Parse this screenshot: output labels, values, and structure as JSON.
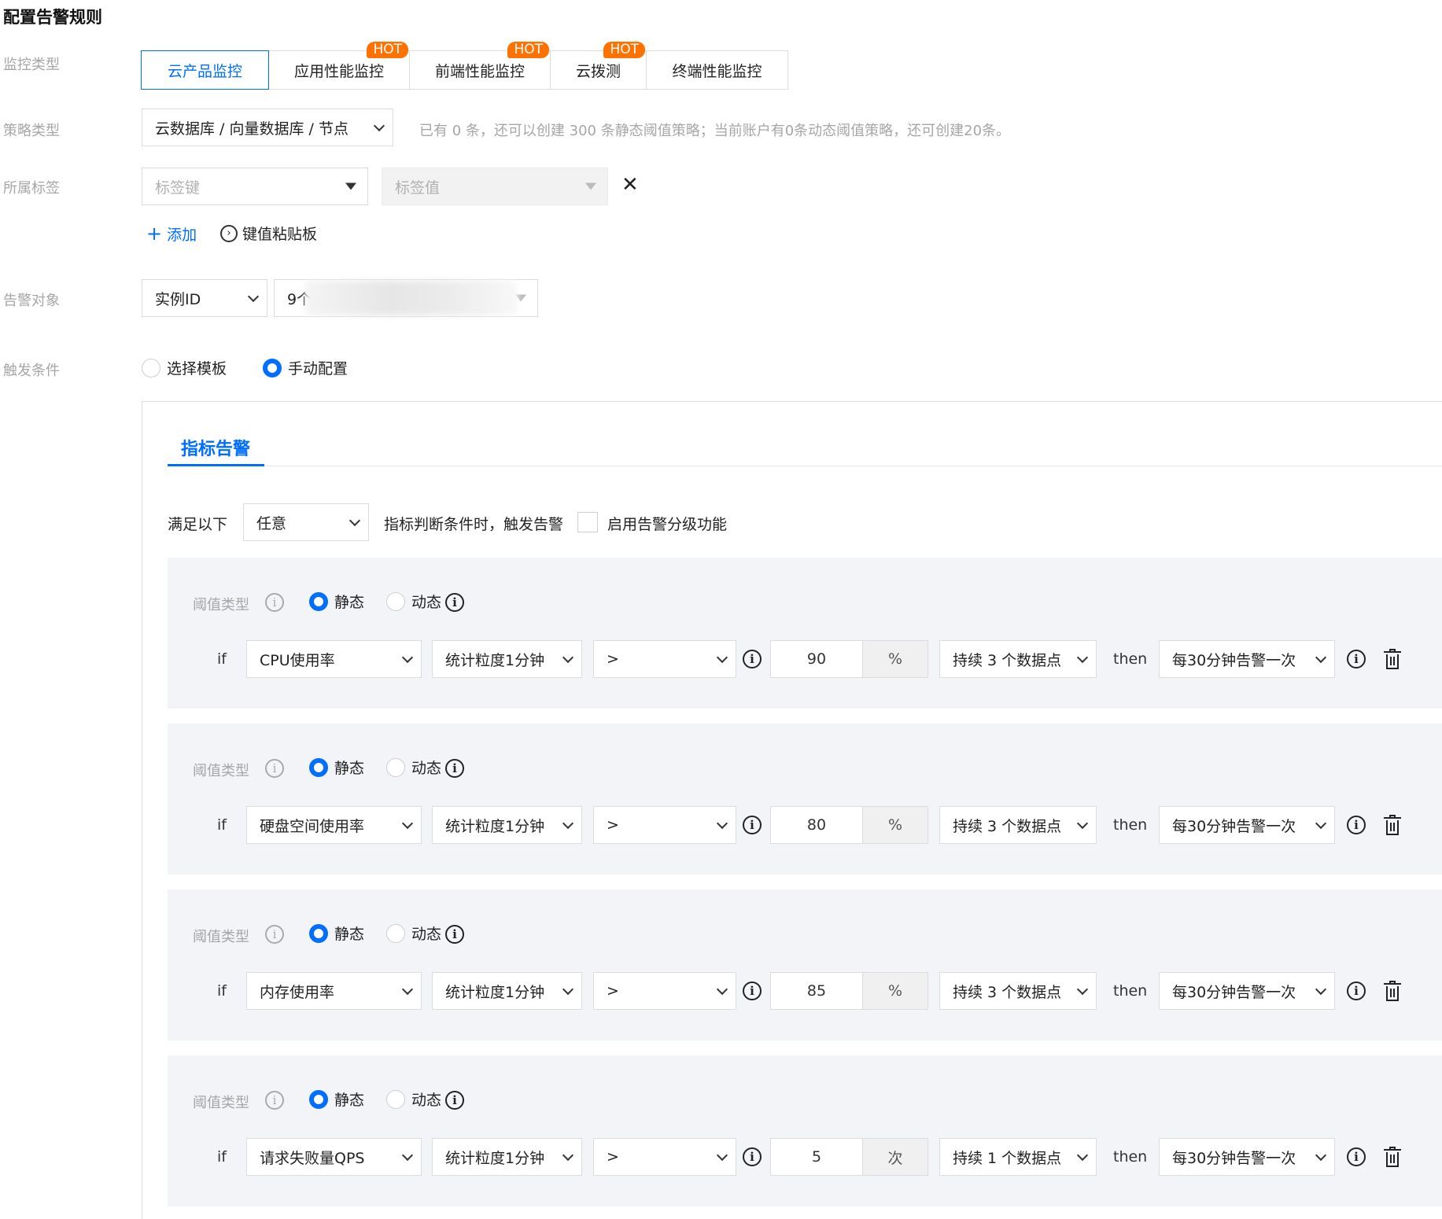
{
  "page_title": "配置告警规则",
  "labels": {
    "monitor_type": "监控类型",
    "policy_type": "策略类型",
    "tags": "所属标签",
    "alarm_object": "告警对象",
    "trigger": "触发条件"
  },
  "monitor_tabs": [
    {
      "label": "云产品监控",
      "hot": false,
      "active": true
    },
    {
      "label": "应用性能监控",
      "hot": true,
      "active": false
    },
    {
      "label": "前端性能监控",
      "hot": true,
      "active": false
    },
    {
      "label": "云拨测",
      "hot": true,
      "active": false
    },
    {
      "label": "终端性能监控",
      "hot": false,
      "active": false
    }
  ],
  "hot_label": "HOT",
  "policy": {
    "value": "云数据库 / 向量数据库 / 节点",
    "hint": "已有 0 条，还可以创建 300 条静态阈值策略；当前账户有0条动态阈值策略，还可创建20条。"
  },
  "tags": {
    "key_placeholder": "标签键",
    "value_placeholder": "标签值",
    "add_label": "添加",
    "add_icon": "+",
    "clipboard_label": "键值粘贴板"
  },
  "alarm_object": {
    "type": "实例ID",
    "value_prefix": "9个"
  },
  "trigger": {
    "template_option": "选择模板",
    "manual_option": "手动配置",
    "selected": "manual"
  },
  "metric_tab": "指标告警",
  "satisfy": {
    "prefix": "满足以下",
    "mode": "任意",
    "suffix": "指标判断条件时，触发告警",
    "grading_label": "启用告警分级功能"
  },
  "condition_labels": {
    "threshold_type": "阈值类型",
    "static": "静态",
    "dynamic": "动态",
    "if": "if",
    "then": "then"
  },
  "conditions": [
    {
      "metric": "CPU使用率",
      "period": "统计粒度1分钟",
      "operator": ">",
      "value": "90",
      "unit": "%",
      "duration": "持续 3 个数据点",
      "frequency": "每30分钟告警一次"
    },
    {
      "metric": "硬盘空间使用率",
      "period": "统计粒度1分钟",
      "operator": ">",
      "value": "80",
      "unit": "%",
      "duration": "持续 3 个数据点",
      "frequency": "每30分钟告警一次"
    },
    {
      "metric": "内存使用率",
      "period": "统计粒度1分钟",
      "operator": ">",
      "value": "85",
      "unit": "%",
      "duration": "持续 3 个数据点",
      "frequency": "每30分钟告警一次"
    },
    {
      "metric": "请求失败量QPS",
      "period": "统计粒度1分钟",
      "operator": ">",
      "value": "5",
      "unit": "次",
      "duration": "持续 1 个数据点",
      "frequency": "每30分钟告警一次"
    }
  ],
  "colors": {
    "accent": "#006eff",
    "hot_badge": "#ff7200",
    "condition_bg": "#f3f4f7"
  }
}
